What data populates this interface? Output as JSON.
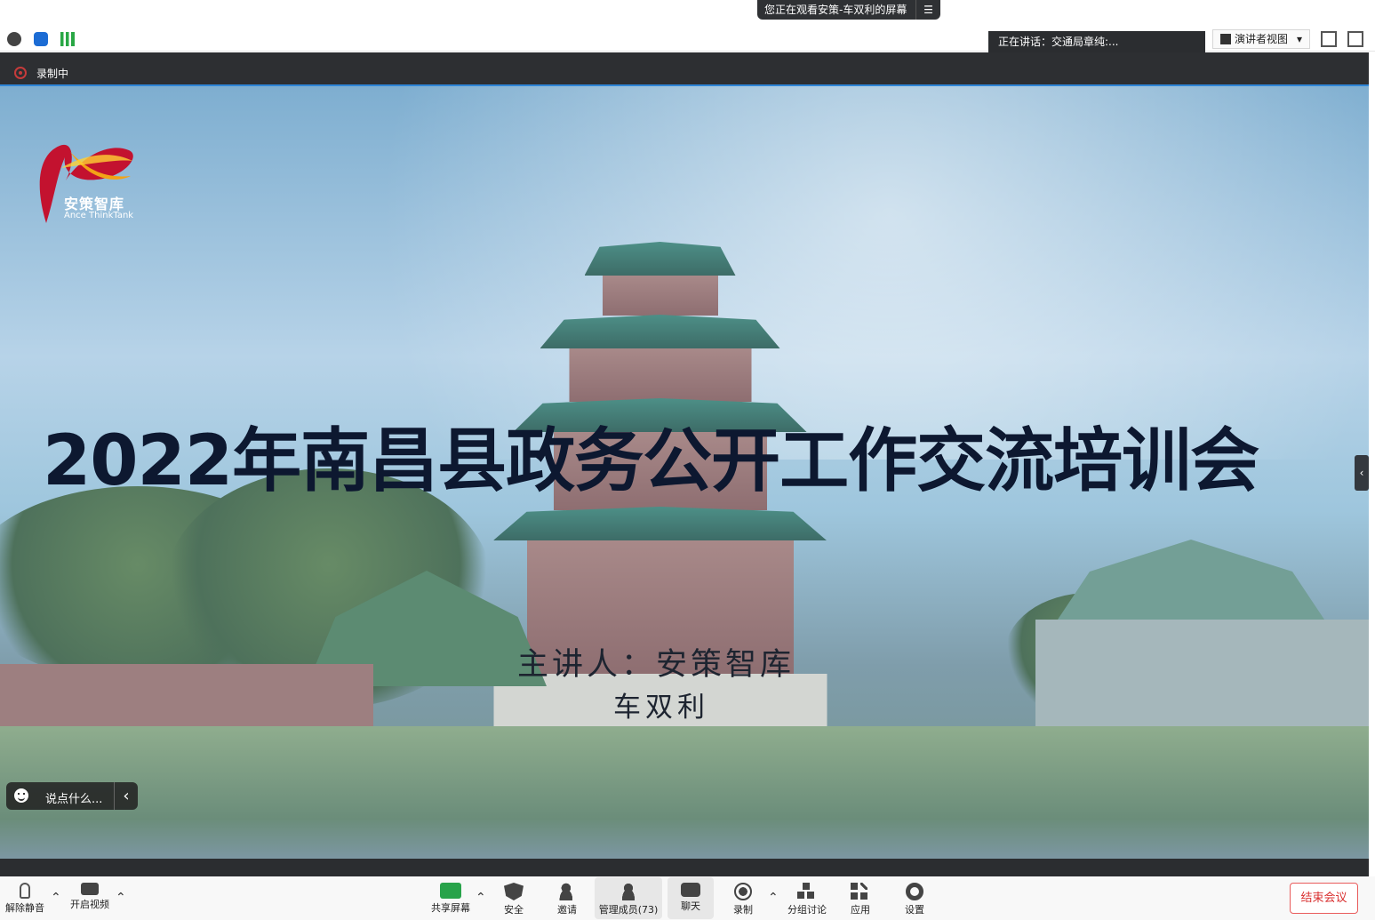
{
  "share_banner": {
    "text": "您正在观看安策-车双利的屏幕",
    "menu_icon": "menu-lines-icon"
  },
  "speaker": {
    "text": "正在讲话：交通局章纯:..."
  },
  "view": {
    "label": "演讲者视图"
  },
  "recording": {
    "label": "录制中"
  },
  "slide": {
    "logo_cn": "安策智库",
    "logo_en": "Ance ThinkTank",
    "title": "2022年南昌县政务公开工作交流培训会",
    "presenter_line1": "主讲人：安策智库",
    "presenter_line2": "车双利"
  },
  "chat_input": {
    "placeholder": "说点什么..."
  },
  "controls": {
    "unmute": "解除静音",
    "start_video": "开启视频",
    "share_screen": "共享屏幕",
    "security": "安全",
    "invite": "邀请",
    "manage": "管理成员(73)",
    "chat": "聊天",
    "record": "录制",
    "breakout": "分组讨论",
    "apps": "应用",
    "settings": "设置",
    "end": "结束会议"
  },
  "colors": {
    "accent": "#2f86d8",
    "end": "#d93030",
    "title": "#0d1830"
  }
}
